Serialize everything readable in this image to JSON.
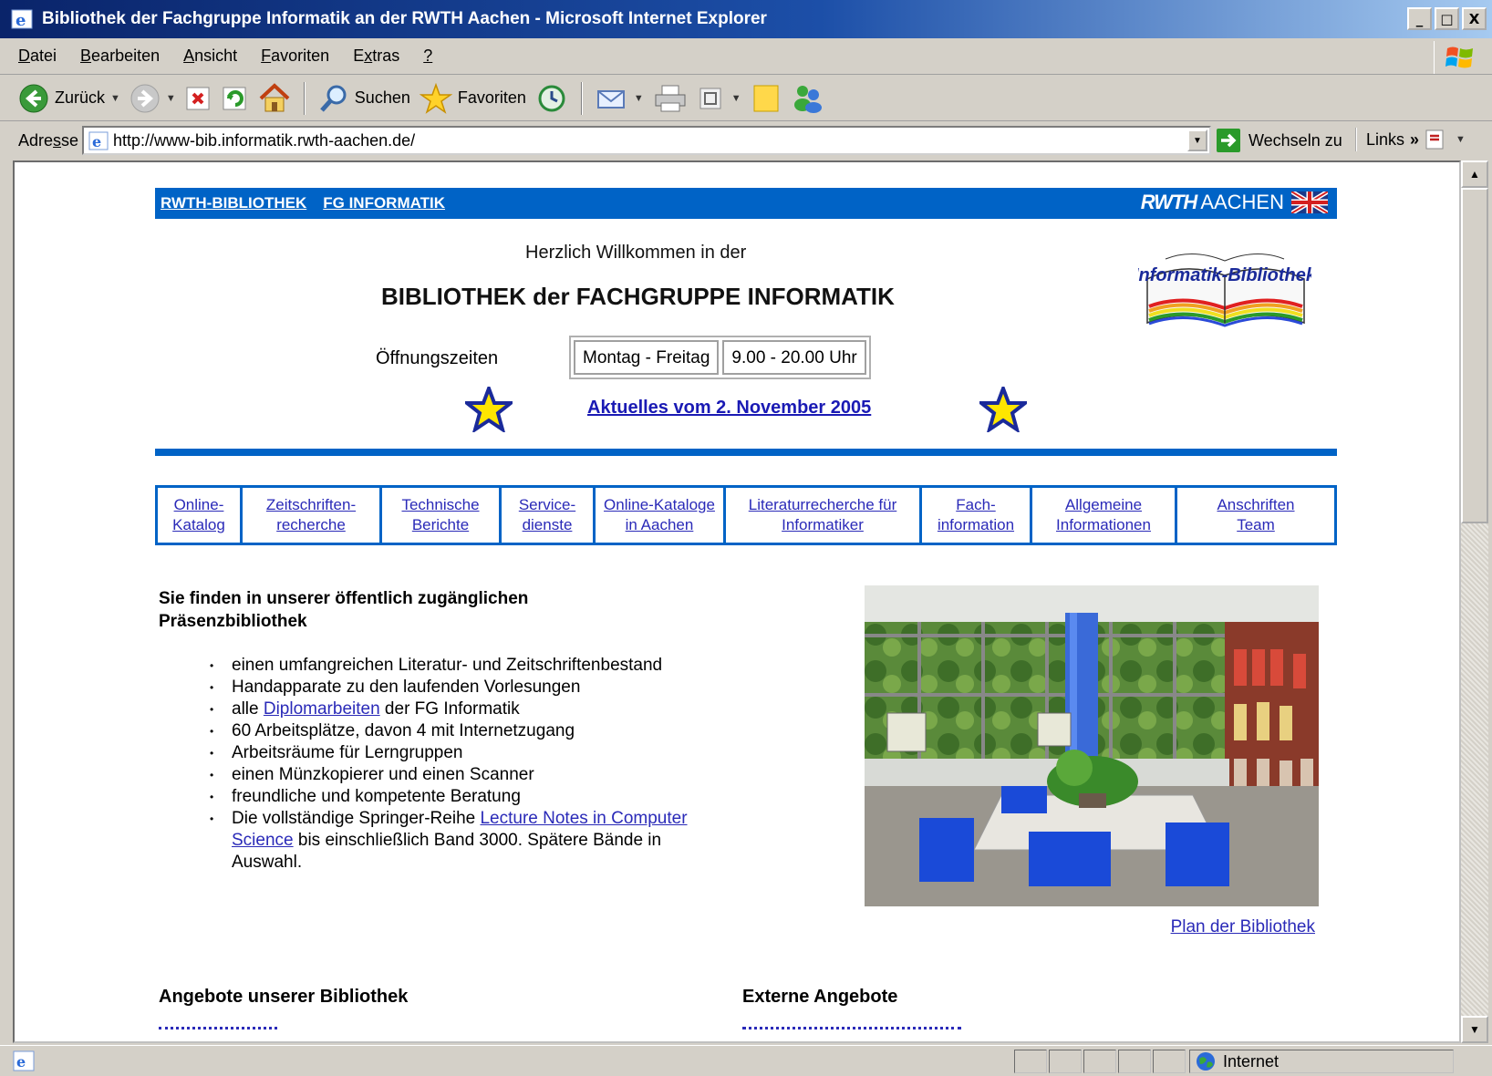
{
  "window": {
    "title": "Bibliothek der Fachgruppe Informatik an der RWTH Aachen - Microsoft Internet Explorer",
    "buttons": [
      "_",
      "□",
      "X"
    ]
  },
  "menubar": {
    "items": [
      {
        "pre": "",
        "key": "D",
        "post": "atei"
      },
      {
        "pre": "",
        "key": "B",
        "post": "earbeiten"
      },
      {
        "pre": "",
        "key": "A",
        "post": "nsicht"
      },
      {
        "pre": "",
        "key": "F",
        "post": "avoriten"
      },
      {
        "pre": "E",
        "key": "x",
        "post": "tras"
      },
      {
        "pre": "",
        "key": "?",
        "post": ""
      }
    ]
  },
  "toolbar": {
    "back_label": "Zurück",
    "search_label": "Suchen",
    "favorites_label": "Favoriten"
  },
  "addressbar": {
    "label_pre": "Adre",
    "label_key": "s",
    "label_post": "se",
    "url": "http://www-bib.informatik.rwth-aachen.de/",
    "go_label": "Wechseln zu",
    "links_label": "Links"
  },
  "page": {
    "topnav": {
      "links": [
        "RWTH-BIBLIOTHEK",
        "FG INFORMATIK"
      ],
      "logo_bold": "RWTH",
      "logo_text": "AACHEN"
    },
    "welcome": "Herzlich Willkommen in der",
    "heading": "BIBLIOTHEK der FACHGRUPPE INFORMATIK",
    "logo_text": "Informatik-Bibliothek",
    "hours": {
      "label": "Öffnungszeiten",
      "days": "Montag - Freitag",
      "time": "9.00 - 20.00 Uhr"
    },
    "news_link": "Aktuelles vom 2. November 2005",
    "menu": [
      "Online-\nKatalog",
      "Zeitschriften-\nrecherche",
      "Technische\nBerichte",
      "Service-\ndienste",
      "Online-Kataloge\nin Aachen",
      "Literaturrecherche für\nInformatiker",
      "Fach-\ninformation",
      "Allgemeine\nInformationen",
      "Anschriften\nTeam"
    ],
    "intro": "Sie finden in unserer öffentlich zugänglichen\nPräsenzbibliothek",
    "bullets": {
      "b1": "einen umfangreichen Literatur- und Zeitschriftenbestand",
      "b2": "Handapparate zu den laufenden Vorlesungen",
      "b3_pre": "alle ",
      "b3_link": "Diplomarbeiten",
      "b3_post": " der FG Informatik",
      "b4": "60 Arbeitsplätze, davon 4 mit Internetzugang",
      "b5": "Arbeitsräume für Lerngruppen",
      "b6": "einen Münzkopierer und einen Scanner",
      "b7": "freundliche und kompetente Beratung",
      "b8_pre": "Die vollständige Springer-Reihe ",
      "b8_link": "Lecture Notes in Computer Science",
      "b8_post": " bis einschließlich Band 3000. Spätere Bände in Auswahl."
    },
    "plan_link": "Plan der Bibliothek",
    "section_left": "Angebote unserer Bibliothek",
    "section_right": "Externe Angebote"
  },
  "status": {
    "zone": "Internet"
  },
  "colors": {
    "brand_blue": "#0063c6",
    "link": "#2a2ab8",
    "title_gradient_start": "#0a246a"
  }
}
